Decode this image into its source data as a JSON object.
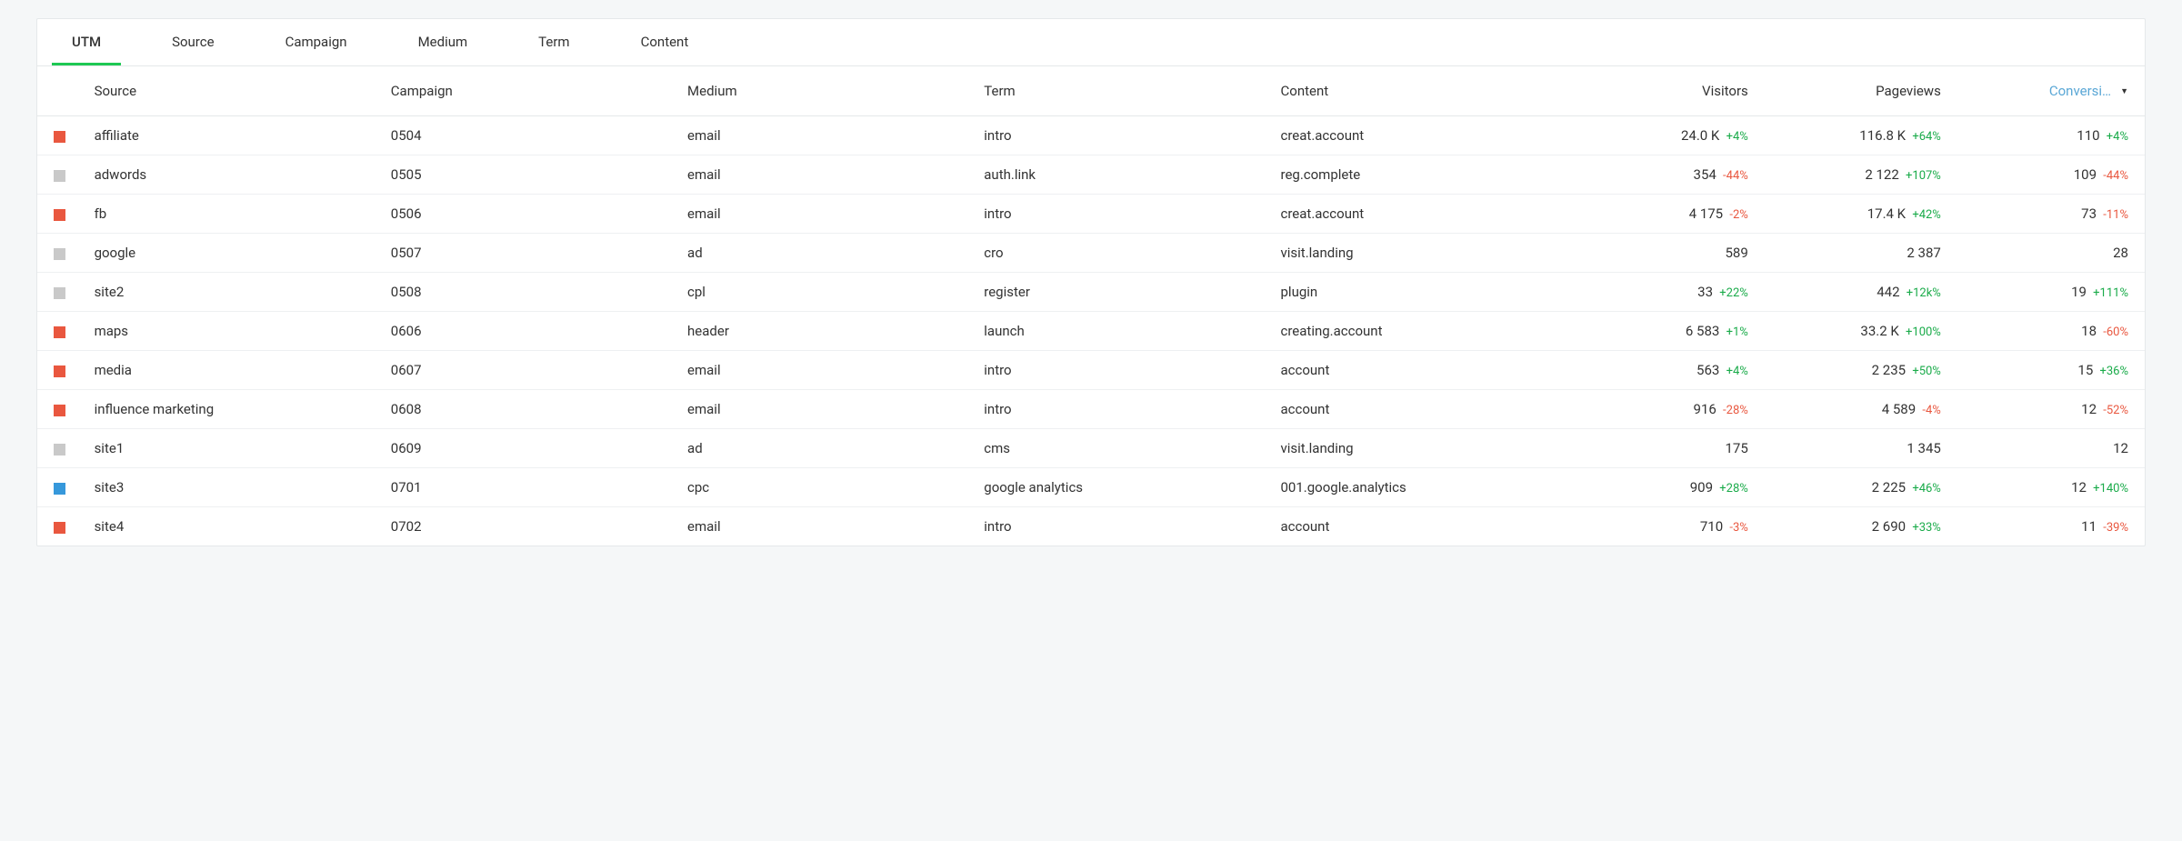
{
  "tabs": [
    "UTM",
    "Source",
    "Campaign",
    "Medium",
    "Term",
    "Content"
  ],
  "activeTab": 0,
  "columns": {
    "source": "Source",
    "campaign": "Campaign",
    "medium": "Medium",
    "term": "Term",
    "content": "Content",
    "visitors": "Visitors",
    "pageviews": "Pageviews",
    "conversions": "Conversi…"
  },
  "sortColumn": "conversions",
  "colors": {
    "orange": "#e9573f",
    "grey": "#c9c9c9",
    "blue": "#3698db"
  },
  "rows": [
    {
      "marker": "orange",
      "source": "affiliate",
      "campaign": "0504",
      "medium": "email",
      "term": "intro",
      "content": "creat.account",
      "visitors": "24.0 K",
      "visitors_d": "+4%",
      "visitors_sign": "pos",
      "pageviews": "116.8 K",
      "pageviews_d": "+64%",
      "pageviews_sign": "pos",
      "conversions": "110",
      "conversions_d": "+4%",
      "conversions_sign": "pos"
    },
    {
      "marker": "grey",
      "source": "adwords",
      "campaign": "0505",
      "medium": "email",
      "term": "auth.link",
      "content": "reg.complete",
      "visitors": "354",
      "visitors_d": "-44%",
      "visitors_sign": "neg",
      "pageviews": "2 122",
      "pageviews_d": "+107%",
      "pageviews_sign": "pos",
      "conversions": "109",
      "conversions_d": "-44%",
      "conversions_sign": "neg"
    },
    {
      "marker": "orange",
      "source": "fb",
      "campaign": "0506",
      "medium": "email",
      "term": "intro",
      "content": "creat.account",
      "visitors": "4 175",
      "visitors_d": "-2%",
      "visitors_sign": "neg",
      "pageviews": "17.4 K",
      "pageviews_d": "+42%",
      "pageviews_sign": "pos",
      "conversions": "73",
      "conversions_d": "-11%",
      "conversions_sign": "neg"
    },
    {
      "marker": "grey",
      "source": "google",
      "campaign": "0507",
      "medium": "ad",
      "term": "cro",
      "content": "visit.landing",
      "visitors": "589",
      "visitors_d": "",
      "visitors_sign": "",
      "pageviews": "2 387",
      "pageviews_d": "",
      "pageviews_sign": "",
      "conversions": "28",
      "conversions_d": "",
      "conversions_sign": ""
    },
    {
      "marker": "grey",
      "source": "site2",
      "campaign": "0508",
      "medium": "cpl",
      "term": "register",
      "content": "plugin",
      "visitors": "33",
      "visitors_d": "+22%",
      "visitors_sign": "pos",
      "pageviews": "442",
      "pageviews_d": "+12k%",
      "pageviews_sign": "pos",
      "conversions": "19",
      "conversions_d": "+111%",
      "conversions_sign": "pos"
    },
    {
      "marker": "orange",
      "source": "maps",
      "campaign": "0606",
      "medium": "header",
      "term": "launch",
      "content": "creating.account",
      "visitors": "6 583",
      "visitors_d": "+1%",
      "visitors_sign": "pos",
      "pageviews": "33.2 K",
      "pageviews_d": "+100%",
      "pageviews_sign": "pos",
      "conversions": "18",
      "conversions_d": "-60%",
      "conversions_sign": "neg"
    },
    {
      "marker": "orange",
      "source": "media",
      "campaign": "0607",
      "medium": "email",
      "term": "intro",
      "content": "account",
      "visitors": "563",
      "visitors_d": "+4%",
      "visitors_sign": "pos",
      "pageviews": "2 235",
      "pageviews_d": "+50%",
      "pageviews_sign": "pos",
      "conversions": "15",
      "conversions_d": "+36%",
      "conversions_sign": "pos"
    },
    {
      "marker": "orange",
      "source": "influence marketing",
      "campaign": "0608",
      "medium": "email",
      "term": "intro",
      "content": "account",
      "visitors": "916",
      "visitors_d": "-28%",
      "visitors_sign": "neg",
      "pageviews": "4 589",
      "pageviews_d": "-4%",
      "pageviews_sign": "neg",
      "conversions": "12",
      "conversions_d": "-52%",
      "conversions_sign": "neg"
    },
    {
      "marker": "grey",
      "source": "site1",
      "campaign": "0609",
      "medium": "ad",
      "term": "cms",
      "content": "visit.landing",
      "visitors": "175",
      "visitors_d": "",
      "visitors_sign": "",
      "pageviews": "1 345",
      "pageviews_d": "",
      "pageviews_sign": "",
      "conversions": "12",
      "conversions_d": "",
      "conversions_sign": ""
    },
    {
      "marker": "blue",
      "source": "site3",
      "campaign": "0701",
      "medium": "cpc",
      "term": "google analytics",
      "content": "001.google.analytics",
      "visitors": "909",
      "visitors_d": "+28%",
      "visitors_sign": "pos",
      "pageviews": "2 225",
      "pageviews_d": "+46%",
      "pageviews_sign": "pos",
      "conversions": "12",
      "conversions_d": "+140%",
      "conversions_sign": "pos"
    },
    {
      "marker": "orange",
      "source": "site4",
      "campaign": "0702",
      "medium": "email",
      "term": "intro",
      "content": "account",
      "visitors": "710",
      "visitors_d": "-3%",
      "visitors_sign": "neg",
      "pageviews": "2 690",
      "pageviews_d": "+33%",
      "pageviews_sign": "pos",
      "conversions": "11",
      "conversions_d": "-39%",
      "conversions_sign": "neg"
    }
  ]
}
